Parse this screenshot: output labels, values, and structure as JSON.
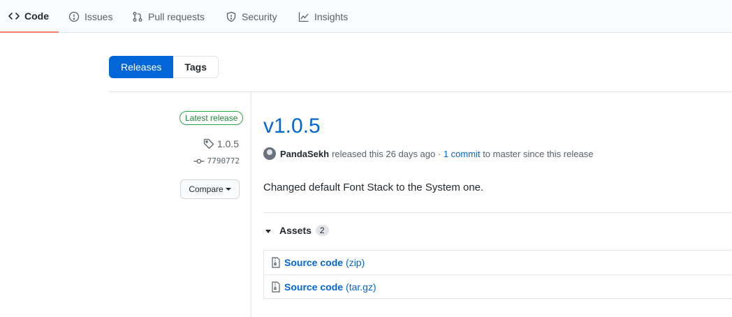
{
  "tabs": [
    {
      "label": "Code",
      "icon": "code-icon"
    },
    {
      "label": "Issues",
      "icon": "issue-icon"
    },
    {
      "label": "Pull requests",
      "icon": "pull-request-icon"
    },
    {
      "label": "Security",
      "icon": "shield-icon"
    },
    {
      "label": "Insights",
      "icon": "graph-icon"
    }
  ],
  "subnav": {
    "releases": "Releases",
    "tags": "Tags"
  },
  "sidebar": {
    "latest_label": "Latest release",
    "tag": "1.0.5",
    "commit": "7790772",
    "compare_label": "Compare"
  },
  "release": {
    "title": "v1.0.5",
    "author": "PandaSekh",
    "released_text": "released this 26 days ago ·",
    "commits_link": "1 commit",
    "to_master": "to master since this release",
    "description": "Changed default Font Stack to the System one."
  },
  "assets": {
    "label": "Assets",
    "count": "2",
    "items": [
      {
        "name": "Source code",
        "format": "(zip)"
      },
      {
        "name": "Source code",
        "format": "(tar.gz)"
      }
    ]
  },
  "colors": {
    "accent": "#0366d6",
    "tab_underline": "#f9826c",
    "latest_green": "#28a745"
  }
}
